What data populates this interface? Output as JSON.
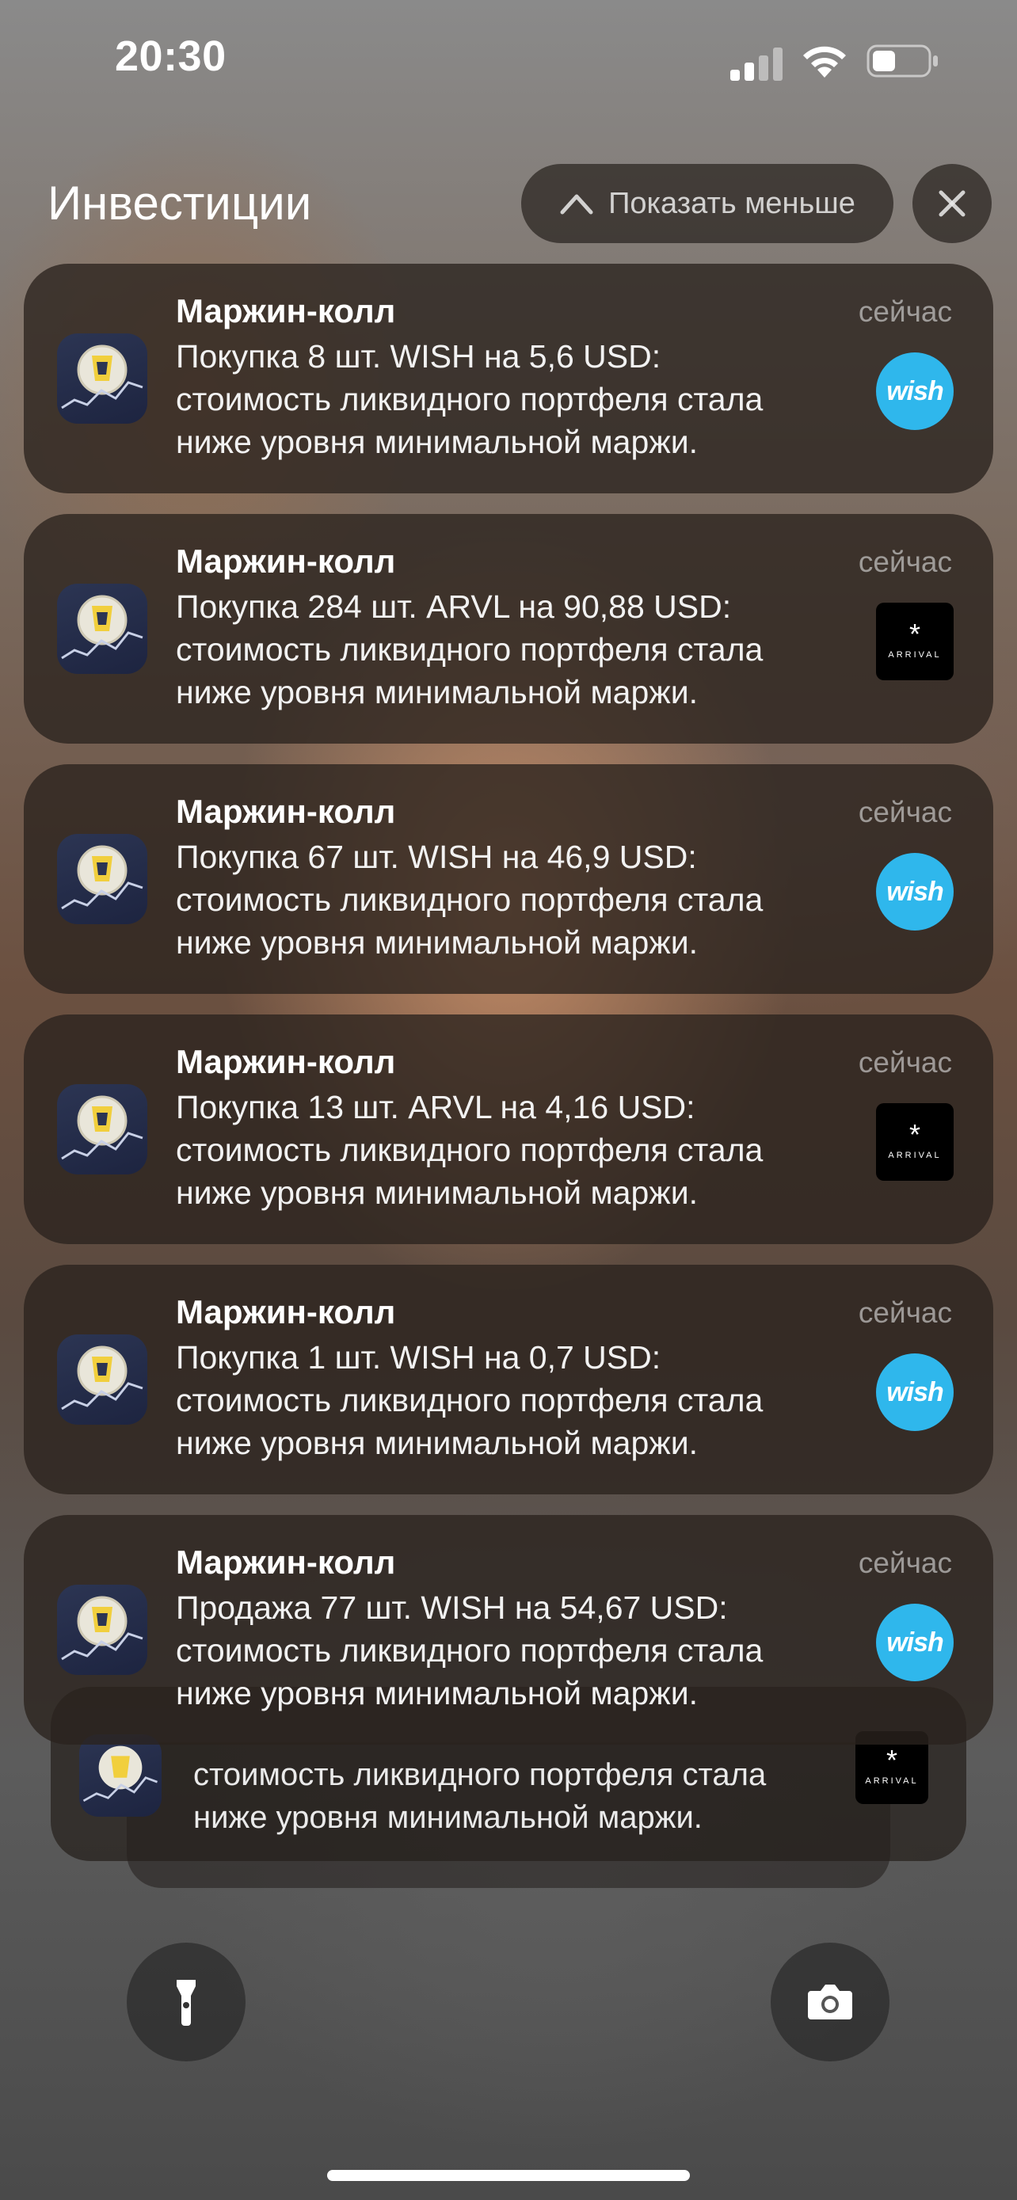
{
  "status_bar": {
    "time": "20:30",
    "signal_icon": "cellular-signal-icon",
    "wifi_icon": "wifi-icon",
    "battery_icon": "battery-icon",
    "battery_level": 0.35
  },
  "group": {
    "title": "Инвестиции",
    "show_less_label": "Показать меньше",
    "show_less_icon": "chevron-up-icon",
    "close_icon": "close-icon"
  },
  "notifications": [
    {
      "title": "Маржин-колл",
      "time": "сейчас",
      "line1": "Покупка 8 шт. WISH на 5,6 USD:",
      "line2": "стоимость ликвидного портфеля стала",
      "line3": "ниже уровня минимальной маржи.",
      "thumb": "wish",
      "thumb_text": "wish"
    },
    {
      "title": "Маржин-колл",
      "time": "сейчас",
      "line1": "Покупка 284 шт. ARVL на 90,88 USD:",
      "line2": "стоимость ликвидного портфеля стала",
      "line3": "ниже уровня минимальной маржи.",
      "thumb": "arrival",
      "thumb_text": "ARRIVAL"
    },
    {
      "title": "Маржин-колл",
      "time": "сейчас",
      "line1": "Покупка 67 шт. WISH на 46,9 USD:",
      "line2": "стоимость ликвидного портфеля стала",
      "line3": "ниже уровня минимальной маржи.",
      "thumb": "wish",
      "thumb_text": "wish"
    },
    {
      "title": "Маржин-колл",
      "time": "сейчас",
      "line1": "Покупка 13 шт. ARVL на 4,16 USD:",
      "line2": "стоимость ликвидного портфеля стала",
      "line3": "ниже уровня минимальной маржи.",
      "thumb": "arrival",
      "thumb_text": "ARRIVAL"
    },
    {
      "title": "Маржин-колл",
      "time": "сейчас",
      "line1": "Покупка 1 шт. WISH на 0,7 USD:",
      "line2": "стоимость ликвидного портфеля стала",
      "line3": "ниже уровня минимальной маржи.",
      "thumb": "wish",
      "thumb_text": "wish"
    },
    {
      "title": "Маржин-колл",
      "time": "сейчас",
      "line1": "Продажа 77 шт. WISH на 54,67 USD:",
      "line2": "стоимость ликвидного портфеля стала",
      "line3": "ниже уровня минимальной маржи.",
      "thumb": "wish",
      "thumb_text": "wish"
    }
  ],
  "stacked_notification": {
    "line1": "стоимость ликвидного портфеля стала",
    "line2": "ниже уровня минимальной маржи.",
    "thumb": "arrival",
    "thumb_text": "ARRIVAL"
  },
  "bottom": {
    "flashlight_icon": "flashlight-icon",
    "camera_icon": "camera-icon"
  },
  "colors": {
    "wish_blue": "#2fb7ec",
    "arrival_black": "#000000",
    "app_icon_navy": "#2c3553",
    "card_bg": "#2a221e"
  }
}
